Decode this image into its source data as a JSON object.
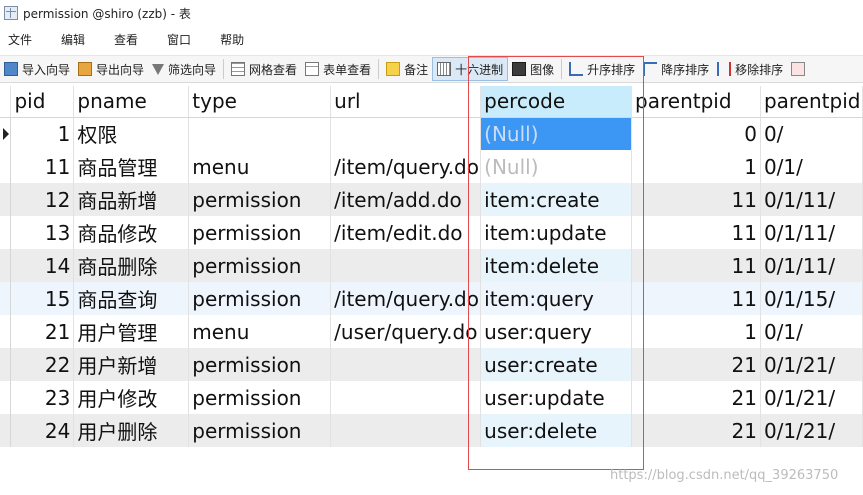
{
  "window": {
    "title": "permission @shiro (zzb) - 表"
  },
  "menu": [
    "文件",
    "编辑",
    "查看",
    "窗口",
    "帮助"
  ],
  "toolbar": {
    "import_wizard": "导入向导",
    "export_wizard": "导出向导",
    "filter_wizard": "筛选向导",
    "grid_view": "网格查看",
    "form_view": "表单查看",
    "memo": "备注",
    "hex": "十六进制",
    "image": "图像",
    "sort_asc": "升序排序",
    "sort_desc": "降序排序",
    "remove_sort": "移除排序"
  },
  "table": {
    "columns": [
      "pid",
      "pname",
      "type",
      "url",
      "percode",
      "parentpid",
      "parentpid"
    ],
    "rows": [
      [
        "1",
        "权限",
        "",
        "",
        "(Null)",
        "0",
        "0/"
      ],
      [
        "11",
        "商品管理",
        "menu",
        "/item/query.do",
        "(Null)",
        "1",
        "0/1/"
      ],
      [
        "12",
        "商品新增",
        "permission",
        "/item/add.do",
        "item:create",
        "11",
        "0/1/11/"
      ],
      [
        "13",
        "商品修改",
        "permission",
        "/item/edit.do",
        "item:update",
        "11",
        "0/1/11/"
      ],
      [
        "14",
        "商品删除",
        "permission",
        "",
        "item:delete",
        "11",
        "0/1/11/"
      ],
      [
        "15",
        "商品查询",
        "permission",
        "/item/query.do",
        "item:query",
        "11",
        "0/1/15/"
      ],
      [
        "21",
        "用户管理",
        "menu",
        "/user/query.do",
        "user:query",
        "1",
        "0/1/"
      ],
      [
        "22",
        "用户新增",
        "permission",
        "",
        "user:create",
        "21",
        "0/1/21/"
      ],
      [
        "23",
        "用户修改",
        "permission",
        "",
        "user:update",
        "21",
        "0/1/21/"
      ],
      [
        "24",
        "用户删除",
        "permission",
        "",
        "user:delete",
        "21",
        "0/1/21/"
      ]
    ]
  },
  "watermark": "https://blog.csdn.net/qq_39263750",
  "colors": {
    "selection": "#3b97f3",
    "highlight_box": "#e24b4b",
    "header_sorted": "#c8ecfb"
  }
}
